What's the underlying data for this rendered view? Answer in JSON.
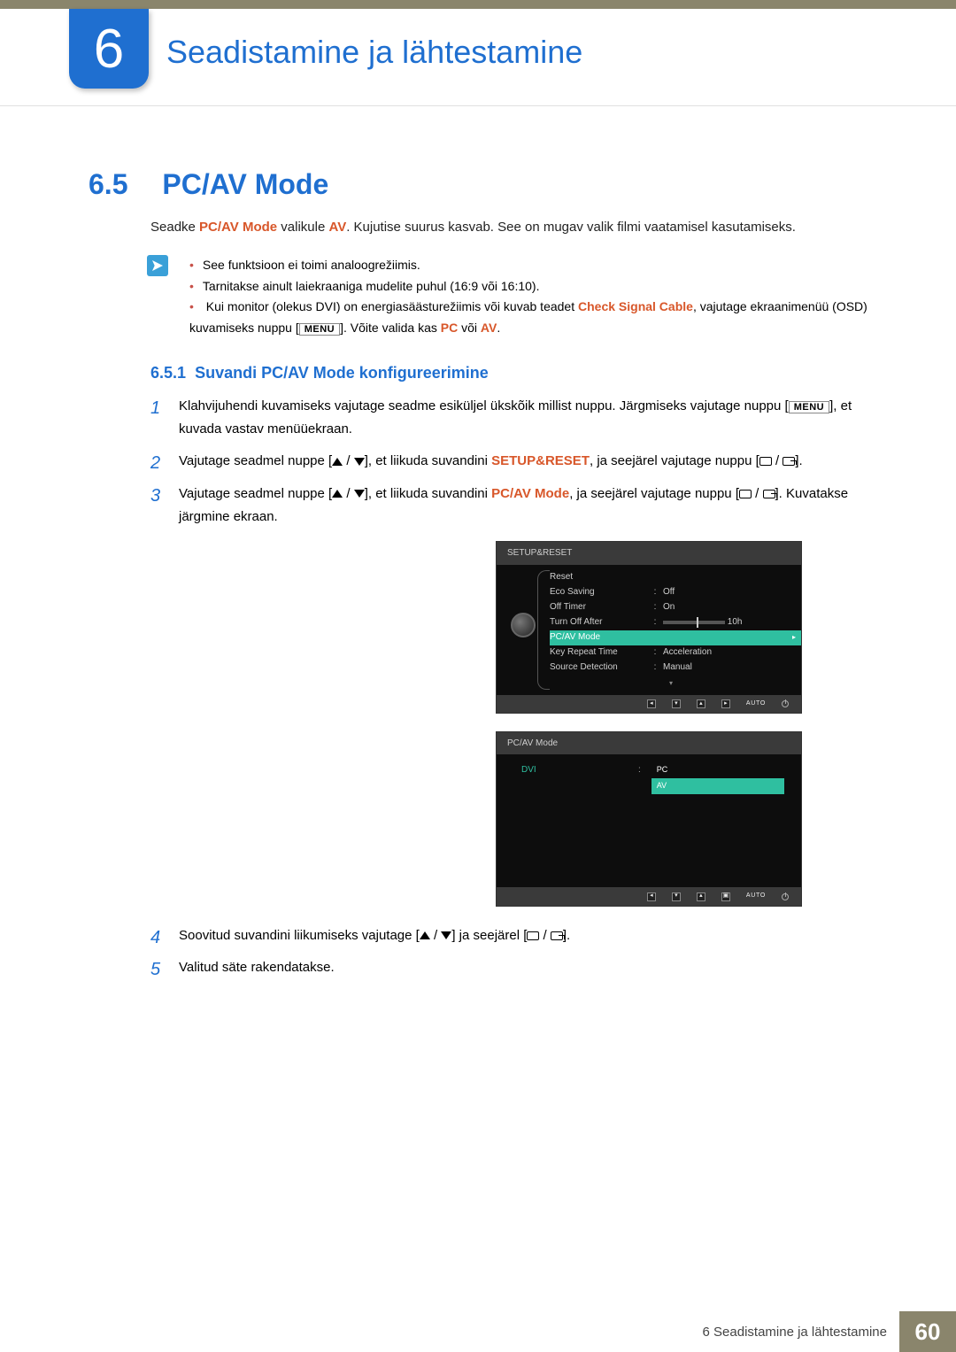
{
  "chapter": {
    "number": "6",
    "title": "Seadistamine ja lähtestamine"
  },
  "section": {
    "number": "6.5",
    "title": "PC/AV Mode"
  },
  "intro": {
    "pre": "Seadke ",
    "term1": "PC/AV Mode",
    "mid": " valikule ",
    "term2": "AV",
    "post": ". Kujutise suurus kasvab. See on mugav valik filmi vaatamisel kasutamiseks."
  },
  "notes": {
    "items": [
      "See funktsioon ei toimi analoogrežiimis.",
      "Tarnitakse ainult laiekraaniga mudelite puhul (16:9 või 16:10)."
    ],
    "n3": {
      "a": "Kui monitor (olekus DVI) on energiasäästurežiimis või kuvab teadet ",
      "b": "Check Signal Cable",
      "c": ", vajutage ekraanimenüü (OSD) kuvamiseks nuppu [",
      "d": "MENU",
      "e": "]. Võite valida kas ",
      "f": "PC",
      "g": " või ",
      "h": "AV",
      "i": "."
    }
  },
  "sub": {
    "number": "6.5.1",
    "title": "Suvandi PC/AV Mode konfigureerimine"
  },
  "steps": {
    "s1a": "Klahvijuhendi kuvamiseks vajutage seadme esiküljel ükskõik millist nuppu. Järgmiseks vajutage nuppu [",
    "s1b": "MENU",
    "s1c": "], et kuvada vastav menüüekraan.",
    "s2a": "Vajutage seadmel nuppe [",
    "s2b": "], et liikuda suvandini ",
    "s2c": "SETUP&RESET",
    "s2d": ", ja seejärel vajutage nuppu [",
    "s2e": "].",
    "s3a": "Vajutage seadmel nuppe [",
    "s3b": "], et liikuda suvandini ",
    "s3c": "PC/AV Mode",
    "s3d": ", ja seejärel vajutage nuppu [",
    "s3e": "]. Kuvatakse järgmine ekraan.",
    "s4a": "Soovitud suvandini liikumiseks vajutage [",
    "s4b": "] ja seejärel [",
    "s4c": "].",
    "s5": "Valitud säte rakendatakse."
  },
  "osd1": {
    "title": "SETUP&RESET",
    "rows": [
      {
        "label": "Reset",
        "value": ""
      },
      {
        "label": "Eco Saving",
        "value": "Off"
      },
      {
        "label": "Off Timer",
        "value": "On"
      },
      {
        "label": "Turn Off After",
        "value": "10h",
        "slider": true
      },
      {
        "label": "PC/AV Mode",
        "value": "",
        "highlight": true
      },
      {
        "label": "Key Repeat Time",
        "value": "Acceleration"
      },
      {
        "label": "Source Detection",
        "value": "Manual"
      }
    ],
    "nav": {
      "auto": "AUTO"
    }
  },
  "osd2": {
    "title": "PC/AV Mode",
    "label": "DVI",
    "values": [
      "PC",
      "AV"
    ],
    "nav": {
      "auto": "AUTO"
    }
  },
  "footer": {
    "text": "6 Seadistamine ja lähtestamine",
    "page": "60"
  }
}
